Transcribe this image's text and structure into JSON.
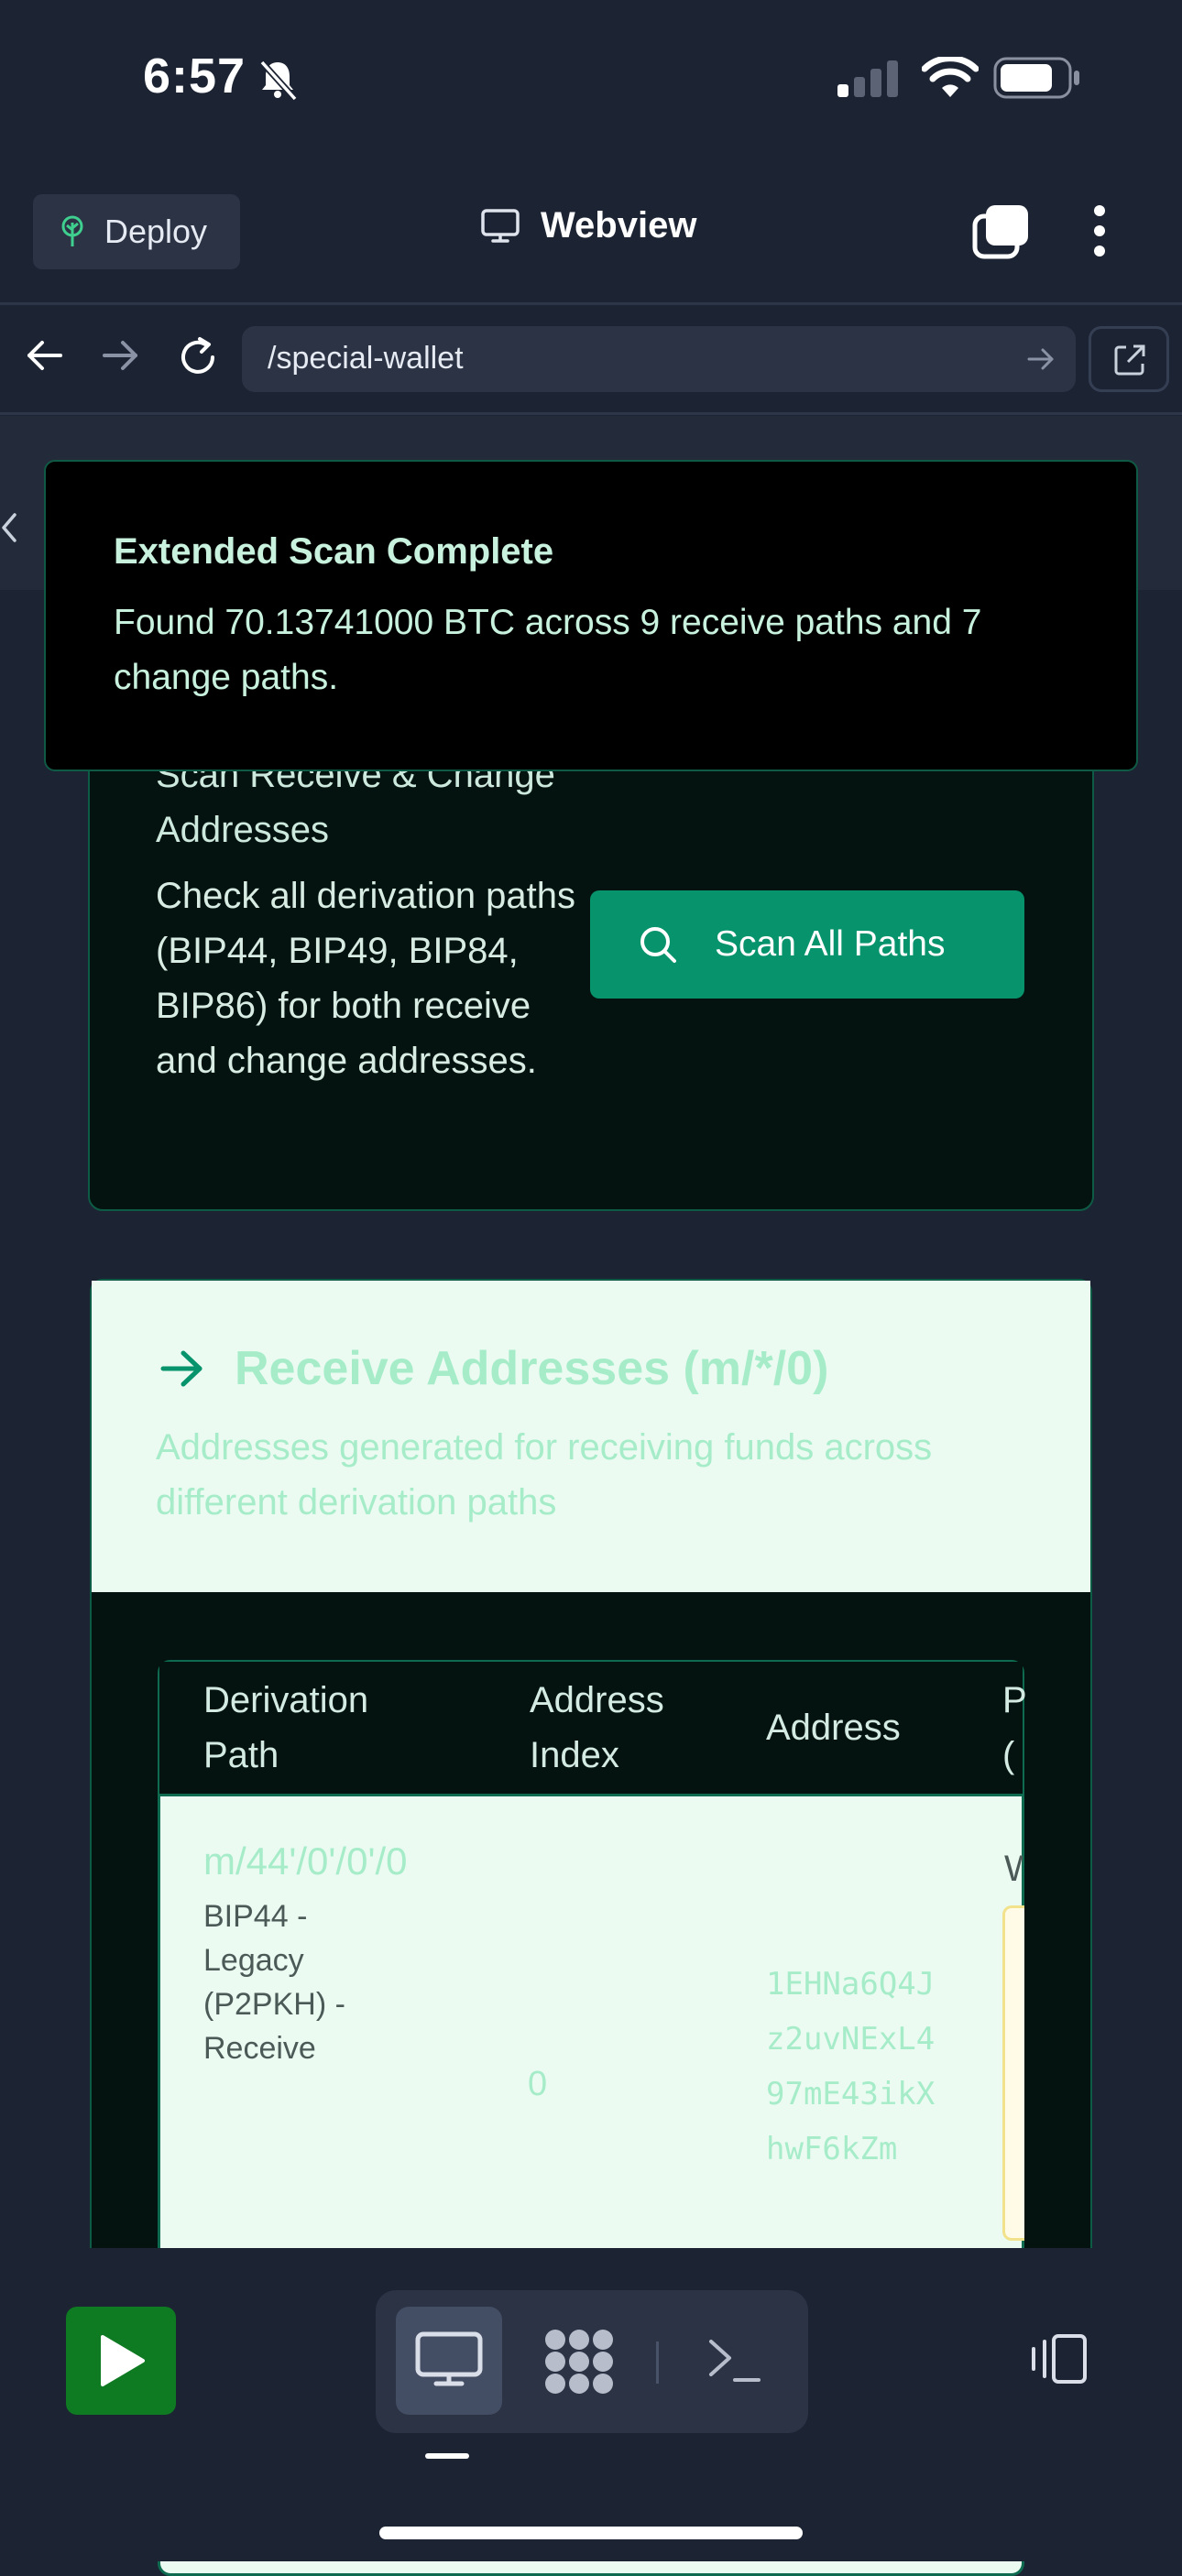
{
  "status_bar": {
    "time": "6:57"
  },
  "toolbar": {
    "deploy_label": "Deploy",
    "webview_label": "Webview"
  },
  "url_bar": {
    "url": "/special-wallet"
  },
  "toast": {
    "title": "Extended Scan Complete",
    "message": "Found 70.13741000 BTC across 9 receive paths and 7 change paths."
  },
  "scan_card": {
    "title": "Scan Receive & Change Addresses",
    "description": "Check all derivation paths (BIP44, BIP49, BIP84, BIP86) for both receive and change addresses.",
    "button_label": "Scan All Paths"
  },
  "receive_card": {
    "title": "Receive Addresses (m/*/0)",
    "subtitle": "Addresses generated for receiving funds across different derivation paths",
    "columns": [
      "Derivation Path",
      "Address Index",
      "Address",
      "P ("
    ],
    "rows": [
      {
        "path": "m/44'/0'/0'/0",
        "type": "BIP44 - Legacy (P2PKH) - Receive",
        "index": "0",
        "address": "1EHNa6Q4Jz2uvNExL497mE43ikXhwF6kZm",
        "truncated": "W"
      }
    ]
  },
  "colors": {
    "accent_green": "#07936c",
    "card_bg": "#04130f",
    "light_mint": "#ebfbf2",
    "mint_text": "#a6ecc9",
    "play_green": "#0e7a22"
  }
}
